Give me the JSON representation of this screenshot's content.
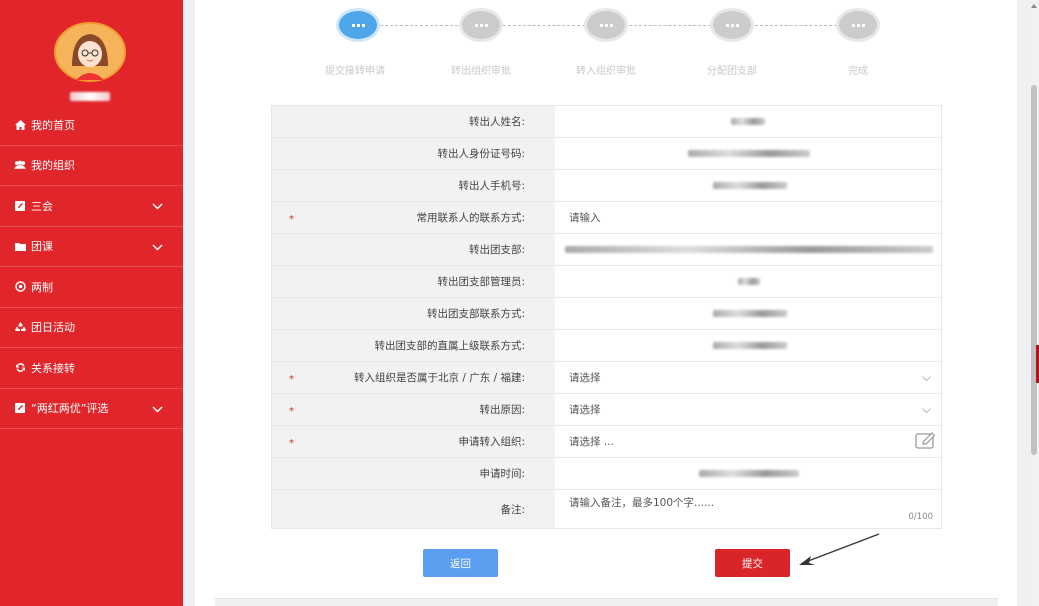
{
  "sidebar": {
    "items": [
      {
        "label": "我的首页",
        "icon": "home-icon",
        "chevron": false
      },
      {
        "label": "我的组织",
        "icon": "users-icon",
        "chevron": false
      },
      {
        "label": "三会",
        "icon": "edit-square-icon",
        "chevron": true
      },
      {
        "label": "团课",
        "icon": "folder-icon",
        "chevron": true
      },
      {
        "label": "两制",
        "icon": "target-icon",
        "chevron": false
      },
      {
        "label": "团日活动",
        "icon": "recycle-icon",
        "chevron": false
      },
      {
        "label": "关系接转",
        "icon": "refresh-icon",
        "chevron": false
      },
      {
        "label": "“两红两优”评选",
        "icon": "edit-square-icon",
        "chevron": true
      }
    ]
  },
  "steps": [
    {
      "label": "提交接转申请",
      "active": true
    },
    {
      "label": "转出组织审批",
      "active": false
    },
    {
      "label": "转入组织审批",
      "active": false
    },
    {
      "label": "分配团支部",
      "active": false
    },
    {
      "label": "完成",
      "active": false
    }
  ],
  "form": {
    "rows": [
      {
        "label": "转出人姓名:",
        "required": false,
        "value": ""
      },
      {
        "label": "转出人身份证号码:",
        "required": false,
        "value": ""
      },
      {
        "label": "转出人手机号:",
        "required": false,
        "value": ""
      },
      {
        "label": "常用联系人的联系方式:",
        "required": true,
        "value": "请输入"
      },
      {
        "label": "转出团支部:",
        "required": false,
        "value": ""
      },
      {
        "label": "转出团支部管理员:",
        "required": false,
        "value": ""
      },
      {
        "label": "转出团支部联系方式:",
        "required": false,
        "value": ""
      },
      {
        "label": "转出团支部的直属上级联系方式:",
        "required": false,
        "value": ""
      },
      {
        "label": "转入组织是否属于北京 / 广东 / 福建:",
        "required": true,
        "value": "请选择"
      },
      {
        "label": "转出原因:",
        "required": true,
        "value": "请选择"
      },
      {
        "label": "申请转入组织:",
        "required": true,
        "value": "请选择 ..."
      },
      {
        "label": "申请时间:",
        "required": false,
        "value": ""
      },
      {
        "label": "备注:",
        "required": false,
        "value": "请输入备注，最多100个字......",
        "counter": "0/100"
      }
    ],
    "required_mark": "*"
  },
  "buttons": {
    "back": "返回",
    "submit": "提交"
  },
  "colors": {
    "sidebar": "#e0262b",
    "active_step": "#4ea5e8",
    "back_button": "#5b9ef0",
    "submit_button": "#d9252a"
  }
}
